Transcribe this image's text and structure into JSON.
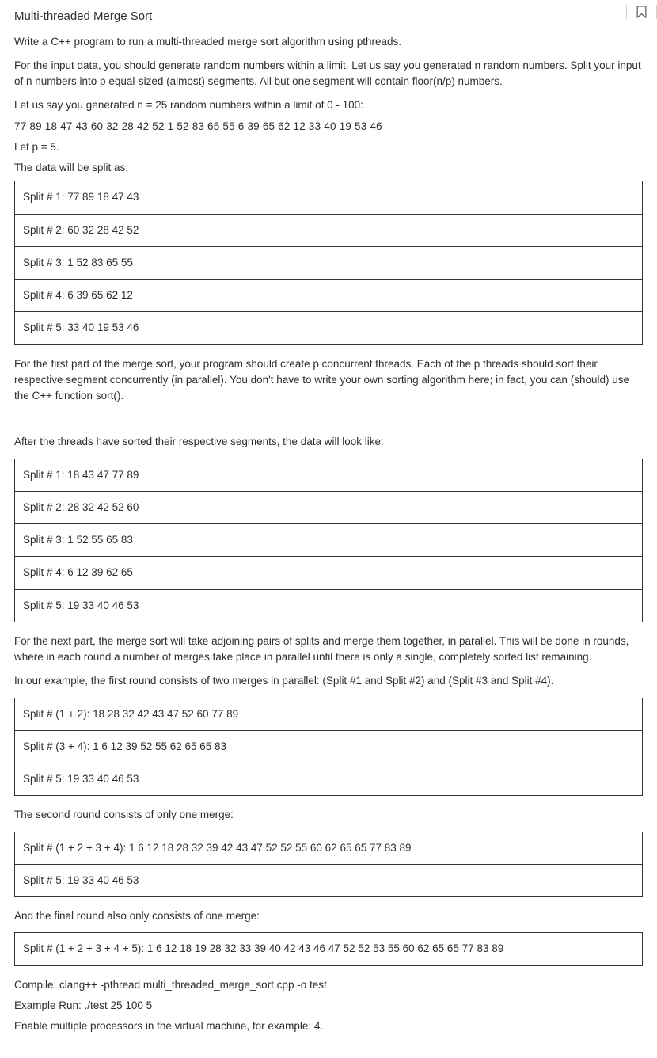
{
  "title": "Multi-threaded Merge Sort",
  "para_intro": "Write a C++ program to run a multi-threaded merge sort algorithm using pthreads.",
  "para_input": "For the input data, you should generate random numbers within a limit. Let us say you generated n random numbers. Split your input of n numbers into p equal-sized (almost) segments. All but one segment will contain floor(n/p) numbers.",
  "line_example_intro": "Let us say you generated n = 25 random numbers within a limit of 0 - 100:",
  "numbers_line": "77 89 18 47 43 60 32 28 42 52 1 52 83 65 55 6 39 65 62 12 33 40 19 53 46",
  "let_p": "Let p = 5.",
  "data_split_intro": "The data will be split as:",
  "splits_initial": [
    "Split # 1: 77 89 18 47 43",
    "Split # 2: 60 32 28 42 52",
    "Split # 3: 1 52 83 65 55",
    "Split # 4: 6 39 65 62 12",
    "Split # 5: 33 40 19 53 46"
  ],
  "para_first_part": "For the first part of the merge sort, your program should create p concurrent threads. Each of the p threads should sort their respective segment concurrently (in parallel). You don't have to write your own sorting algorithm here; in fact, you can (should) use the C++ function sort().",
  "after_sorted_intro": "After the threads have sorted their respective segments, the data will look like:",
  "splits_sorted": [
    "Split # 1: 18 43 47 77 89",
    "Split # 2: 28 32 42 52 60",
    "Split # 3: 1 52 55 65 83",
    "Split # 4: 6 12 39 62 65",
    "Split # 5: 19 33 40 46 53"
  ],
  "para_next_part": "For the next part, the merge sort will take adjoining pairs of splits and merge them together, in parallel. This will be done in rounds, where in each round a number of merges take place in parallel until there is only a single, completely sorted list remaining.",
  "para_round1_intro": "In our example, the first round consists of two merges in parallel: (Split #1 and Split #2) and (Split #3 and Split #4).",
  "splits_round1": [
    "Split # (1 + 2): 18 28 32 42 43 47 52 60 77 89",
    "Split # (3 + 4): 1 6 12 39 52 55 62 65 65 83",
    "Split # 5: 19 33 40 46 53"
  ],
  "para_round2_intro": "The second round consists of only one merge:",
  "splits_round2": [
    "Split # (1 + 2 + 3 + 4): 1 6 12 18 28 32 39 42 43 47 52 52 55 60 62 65 65 77 83 89",
    "Split # 5: 19 33 40 46 53"
  ],
  "para_final_intro": "And the final round also only consists of one merge:",
  "splits_final": [
    "Split # (1 + 2 + 3 + 4 + 5): 1 6 12 18 19 28 32 33 39 40 42 43 46 47 52 52 53 55 60 62 65 65 77 83 89"
  ],
  "compile_line": "Compile: clang++ -pthread multi_threaded_merge_sort.cpp -o test",
  "run_line": "Example Run: ./test 25 100 5",
  "vm_line": "Enable multiple processors in the virtual machine, for example: 4."
}
